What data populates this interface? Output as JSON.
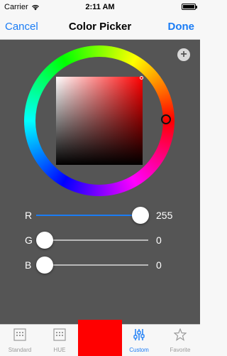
{
  "status": {
    "carrier": "Carrier",
    "time": "2:11 AM"
  },
  "nav": {
    "left": "Cancel",
    "title": "Color Picker",
    "right": "Done"
  },
  "picker": {
    "add_icon": "plus-icon",
    "hue_deg": 0,
    "current_color": "#ff0000"
  },
  "sliders": [
    {
      "label": "R",
      "value": "255",
      "fraction": 1.0
    },
    {
      "label": "G",
      "value": "0",
      "fraction": 0.0
    },
    {
      "label": "B",
      "value": "0",
      "fraction": 0.0
    }
  ],
  "tabs": [
    {
      "label": "Standard",
      "icon": "grid-icon"
    },
    {
      "label": "HUE",
      "icon": "grid-icon"
    },
    {
      "label": "Custom",
      "icon": "sliders-icon",
      "active": true
    },
    {
      "label": "Favorite",
      "icon": "star-icon"
    }
  ],
  "colors": {
    "accent": "#1a7cf5",
    "background": "#555555",
    "swatch": "#ff0000"
  }
}
